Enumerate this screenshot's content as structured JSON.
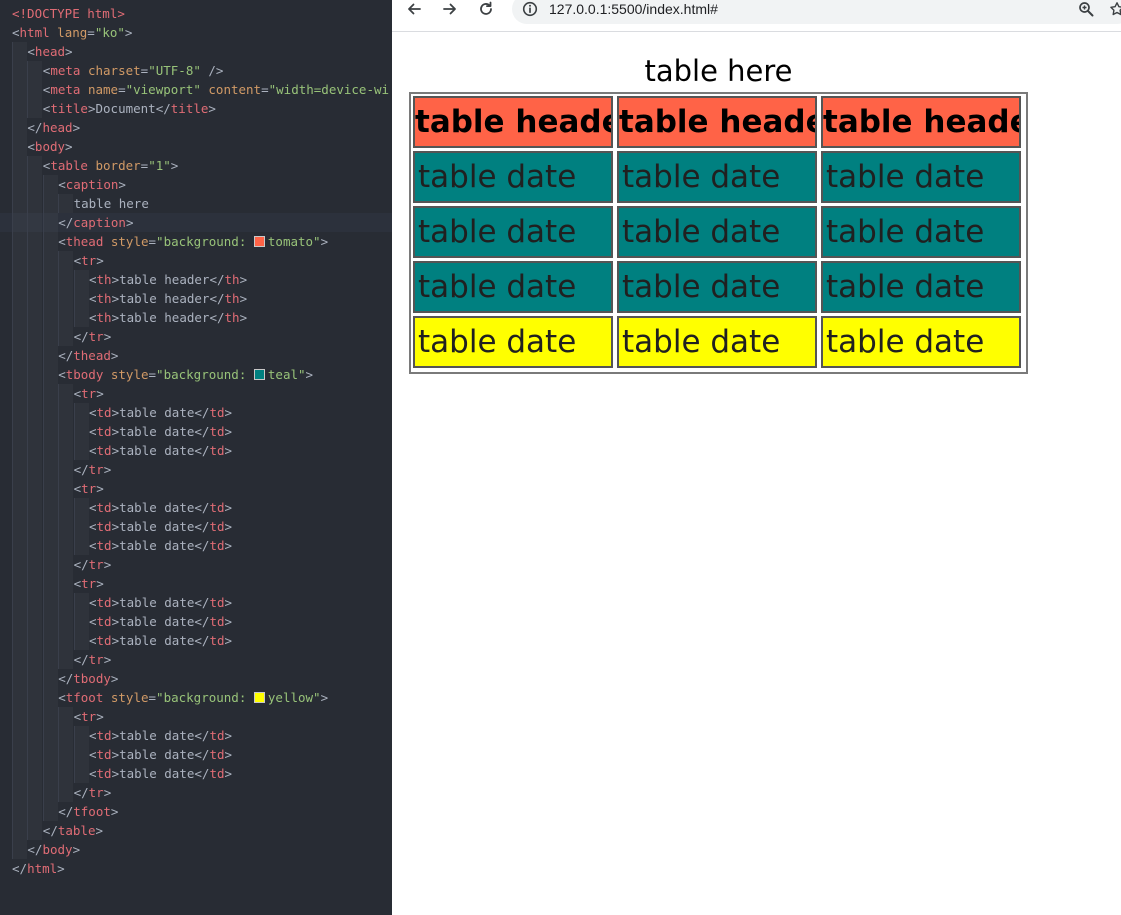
{
  "editor": {
    "lines": [
      {
        "indent": 0,
        "tokens": [
          [
            "tag",
            "<!DOCTYPE html>"
          ]
        ]
      },
      {
        "indent": 0,
        "tokens": [
          [
            "punc",
            "<"
          ],
          [
            "tag",
            "html"
          ],
          [
            "attr",
            " lang"
          ],
          [
            "punc",
            "="
          ],
          [
            "str",
            "\"ko\""
          ],
          [
            "punc",
            ">"
          ]
        ]
      },
      {
        "indent": 1,
        "tokens": [
          [
            "punc",
            "<"
          ],
          [
            "tag",
            "head"
          ],
          [
            "punc",
            ">"
          ]
        ]
      },
      {
        "indent": 2,
        "tokens": [
          [
            "punc",
            "<"
          ],
          [
            "tag",
            "meta"
          ],
          [
            "attr",
            " charset"
          ],
          [
            "punc",
            "="
          ],
          [
            "str",
            "\"UTF-8\""
          ],
          [
            "punc",
            " />"
          ]
        ]
      },
      {
        "indent": 2,
        "tokens": [
          [
            "punc",
            "<"
          ],
          [
            "tag",
            "meta"
          ],
          [
            "attr",
            " name"
          ],
          [
            "punc",
            "="
          ],
          [
            "str",
            "\"viewport\""
          ],
          [
            "attr",
            " content"
          ],
          [
            "punc",
            "="
          ],
          [
            "str",
            "\"width=device-wi"
          ]
        ]
      },
      {
        "indent": 2,
        "tokens": [
          [
            "punc",
            "<"
          ],
          [
            "tag",
            "title"
          ],
          [
            "punc",
            ">"
          ],
          [
            "text",
            "Document"
          ],
          [
            "punc",
            "</"
          ],
          [
            "tag",
            "title"
          ],
          [
            "punc",
            ">"
          ]
        ]
      },
      {
        "indent": 1,
        "tokens": [
          [
            "punc",
            "</"
          ],
          [
            "tag",
            "head"
          ],
          [
            "punc",
            ">"
          ]
        ]
      },
      {
        "indent": 1,
        "tokens": [
          [
            "punc",
            "<"
          ],
          [
            "tag",
            "body"
          ],
          [
            "punc",
            ">"
          ]
        ]
      },
      {
        "indent": 2,
        "tokens": [
          [
            "punc",
            "<"
          ],
          [
            "tag",
            "table"
          ],
          [
            "attr",
            " border"
          ],
          [
            "punc",
            "="
          ],
          [
            "str",
            "\"1\""
          ],
          [
            "punc",
            ">"
          ]
        ]
      },
      {
        "indent": 3,
        "tokens": [
          [
            "punc",
            "<"
          ],
          [
            "tag",
            "caption"
          ],
          [
            "punc",
            ">"
          ]
        ]
      },
      {
        "indent": 4,
        "tokens": [
          [
            "text",
            "table here"
          ]
        ]
      },
      {
        "indent": 3,
        "active": true,
        "tokens": [
          [
            "punc",
            "</"
          ],
          [
            "tag",
            "caption"
          ],
          [
            "punc",
            ">"
          ]
        ]
      },
      {
        "indent": 3,
        "tokens": [
          [
            "punc",
            "<"
          ],
          [
            "tag",
            "thead"
          ],
          [
            "attr",
            " style"
          ],
          [
            "punc",
            "="
          ],
          [
            "str",
            "\"background: "
          ],
          [
            "swatch",
            "#ff6347"
          ],
          [
            "str",
            "tomato\""
          ],
          [
            "punc",
            ">"
          ]
        ]
      },
      {
        "indent": 4,
        "tokens": [
          [
            "punc",
            "<"
          ],
          [
            "tag",
            "tr"
          ],
          [
            "punc",
            ">"
          ]
        ]
      },
      {
        "indent": 5,
        "tokens": [
          [
            "punc",
            "<"
          ],
          [
            "tag",
            "th"
          ],
          [
            "punc",
            ">"
          ],
          [
            "text",
            "table header"
          ],
          [
            "punc",
            "</"
          ],
          [
            "tag",
            "th"
          ],
          [
            "punc",
            ">"
          ]
        ]
      },
      {
        "indent": 5,
        "tokens": [
          [
            "punc",
            "<"
          ],
          [
            "tag",
            "th"
          ],
          [
            "punc",
            ">"
          ],
          [
            "text",
            "table header"
          ],
          [
            "punc",
            "</"
          ],
          [
            "tag",
            "th"
          ],
          [
            "punc",
            ">"
          ]
        ]
      },
      {
        "indent": 5,
        "tokens": [
          [
            "punc",
            "<"
          ],
          [
            "tag",
            "th"
          ],
          [
            "punc",
            ">"
          ],
          [
            "text",
            "table header"
          ],
          [
            "punc",
            "</"
          ],
          [
            "tag",
            "th"
          ],
          [
            "punc",
            ">"
          ]
        ]
      },
      {
        "indent": 4,
        "tokens": [
          [
            "punc",
            "</"
          ],
          [
            "tag",
            "tr"
          ],
          [
            "punc",
            ">"
          ]
        ]
      },
      {
        "indent": 3,
        "tokens": [
          [
            "punc",
            "</"
          ],
          [
            "tag",
            "thead"
          ],
          [
            "punc",
            ">"
          ]
        ]
      },
      {
        "indent": 3,
        "tokens": [
          [
            "punc",
            "<"
          ],
          [
            "tag",
            "tbody"
          ],
          [
            "attr",
            " style"
          ],
          [
            "punc",
            "="
          ],
          [
            "str",
            "\"background: "
          ],
          [
            "swatch",
            "#008080"
          ],
          [
            "str",
            "teal\""
          ],
          [
            "punc",
            ">"
          ]
        ]
      },
      {
        "indent": 4,
        "tokens": [
          [
            "punc",
            "<"
          ],
          [
            "tag",
            "tr"
          ],
          [
            "punc",
            ">"
          ]
        ]
      },
      {
        "indent": 5,
        "tokens": [
          [
            "punc",
            "<"
          ],
          [
            "tag",
            "td"
          ],
          [
            "punc",
            ">"
          ],
          [
            "text",
            "table date"
          ],
          [
            "punc",
            "</"
          ],
          [
            "tag",
            "td"
          ],
          [
            "punc",
            ">"
          ]
        ]
      },
      {
        "indent": 5,
        "tokens": [
          [
            "punc",
            "<"
          ],
          [
            "tag",
            "td"
          ],
          [
            "punc",
            ">"
          ],
          [
            "text",
            "table date"
          ],
          [
            "punc",
            "</"
          ],
          [
            "tag",
            "td"
          ],
          [
            "punc",
            ">"
          ]
        ]
      },
      {
        "indent": 5,
        "tokens": [
          [
            "punc",
            "<"
          ],
          [
            "tag",
            "td"
          ],
          [
            "punc",
            ">"
          ],
          [
            "text",
            "table date"
          ],
          [
            "punc",
            "</"
          ],
          [
            "tag",
            "td"
          ],
          [
            "punc",
            ">"
          ]
        ]
      },
      {
        "indent": 4,
        "tokens": [
          [
            "punc",
            "</"
          ],
          [
            "tag",
            "tr"
          ],
          [
            "punc",
            ">"
          ]
        ]
      },
      {
        "indent": 4,
        "tokens": [
          [
            "punc",
            "<"
          ],
          [
            "tag",
            "tr"
          ],
          [
            "punc",
            ">"
          ]
        ]
      },
      {
        "indent": 5,
        "tokens": [
          [
            "punc",
            "<"
          ],
          [
            "tag",
            "td"
          ],
          [
            "punc",
            ">"
          ],
          [
            "text",
            "table date"
          ],
          [
            "punc",
            "</"
          ],
          [
            "tag",
            "td"
          ],
          [
            "punc",
            ">"
          ]
        ]
      },
      {
        "indent": 5,
        "tokens": [
          [
            "punc",
            "<"
          ],
          [
            "tag",
            "td"
          ],
          [
            "punc",
            ">"
          ],
          [
            "text",
            "table date"
          ],
          [
            "punc",
            "</"
          ],
          [
            "tag",
            "td"
          ],
          [
            "punc",
            ">"
          ]
        ]
      },
      {
        "indent": 5,
        "tokens": [
          [
            "punc",
            "<"
          ],
          [
            "tag",
            "td"
          ],
          [
            "punc",
            ">"
          ],
          [
            "text",
            "table date"
          ],
          [
            "punc",
            "</"
          ],
          [
            "tag",
            "td"
          ],
          [
            "punc",
            ">"
          ]
        ]
      },
      {
        "indent": 4,
        "tokens": [
          [
            "punc",
            "</"
          ],
          [
            "tag",
            "tr"
          ],
          [
            "punc",
            ">"
          ]
        ]
      },
      {
        "indent": 4,
        "tokens": [
          [
            "punc",
            "<"
          ],
          [
            "tag",
            "tr"
          ],
          [
            "punc",
            ">"
          ]
        ]
      },
      {
        "indent": 5,
        "tokens": [
          [
            "punc",
            "<"
          ],
          [
            "tag",
            "td"
          ],
          [
            "punc",
            ">"
          ],
          [
            "text",
            "table date"
          ],
          [
            "punc",
            "</"
          ],
          [
            "tag",
            "td"
          ],
          [
            "punc",
            ">"
          ]
        ]
      },
      {
        "indent": 5,
        "tokens": [
          [
            "punc",
            "<"
          ],
          [
            "tag",
            "td"
          ],
          [
            "punc",
            ">"
          ],
          [
            "text",
            "table date"
          ],
          [
            "punc",
            "</"
          ],
          [
            "tag",
            "td"
          ],
          [
            "punc",
            ">"
          ]
        ]
      },
      {
        "indent": 5,
        "tokens": [
          [
            "punc",
            "<"
          ],
          [
            "tag",
            "td"
          ],
          [
            "punc",
            ">"
          ],
          [
            "text",
            "table date"
          ],
          [
            "punc",
            "</"
          ],
          [
            "tag",
            "td"
          ],
          [
            "punc",
            ">"
          ]
        ]
      },
      {
        "indent": 4,
        "tokens": [
          [
            "punc",
            "</"
          ],
          [
            "tag",
            "tr"
          ],
          [
            "punc",
            ">"
          ]
        ]
      },
      {
        "indent": 3,
        "tokens": [
          [
            "punc",
            "</"
          ],
          [
            "tag",
            "tbody"
          ],
          [
            "punc",
            ">"
          ]
        ]
      },
      {
        "indent": 3,
        "tokens": [
          [
            "punc",
            "<"
          ],
          [
            "tag",
            "tfoot"
          ],
          [
            "attr",
            " style"
          ],
          [
            "punc",
            "="
          ],
          [
            "str",
            "\"background: "
          ],
          [
            "swatch",
            "#ffff00"
          ],
          [
            "str",
            "yellow\""
          ],
          [
            "punc",
            ">"
          ]
        ]
      },
      {
        "indent": 4,
        "tokens": [
          [
            "punc",
            "<"
          ],
          [
            "tag",
            "tr"
          ],
          [
            "punc",
            ">"
          ]
        ]
      },
      {
        "indent": 5,
        "tokens": [
          [
            "punc",
            "<"
          ],
          [
            "tag",
            "td"
          ],
          [
            "punc",
            ">"
          ],
          [
            "text",
            "table date"
          ],
          [
            "punc",
            "</"
          ],
          [
            "tag",
            "td"
          ],
          [
            "punc",
            ">"
          ]
        ]
      },
      {
        "indent": 5,
        "tokens": [
          [
            "punc",
            "<"
          ],
          [
            "tag",
            "td"
          ],
          [
            "punc",
            ">"
          ],
          [
            "text",
            "table date"
          ],
          [
            "punc",
            "</"
          ],
          [
            "tag",
            "td"
          ],
          [
            "punc",
            ">"
          ]
        ]
      },
      {
        "indent": 5,
        "tokens": [
          [
            "punc",
            "<"
          ],
          [
            "tag",
            "td"
          ],
          [
            "punc",
            ">"
          ],
          [
            "text",
            "table date"
          ],
          [
            "punc",
            "</"
          ],
          [
            "tag",
            "td"
          ],
          [
            "punc",
            ">"
          ]
        ]
      },
      {
        "indent": 4,
        "tokens": [
          [
            "punc",
            "</"
          ],
          [
            "tag",
            "tr"
          ],
          [
            "punc",
            ">"
          ]
        ]
      },
      {
        "indent": 3,
        "tokens": [
          [
            "punc",
            "</"
          ],
          [
            "tag",
            "tfoot"
          ],
          [
            "punc",
            ">"
          ]
        ]
      },
      {
        "indent": 2,
        "tokens": [
          [
            "punc",
            "</"
          ],
          [
            "tag",
            "table"
          ],
          [
            "punc",
            ">"
          ]
        ]
      },
      {
        "indent": 1,
        "tokens": [
          [
            "punc",
            "</"
          ],
          [
            "tag",
            "body"
          ],
          [
            "punc",
            ">"
          ]
        ]
      },
      {
        "indent": 0,
        "tokens": [
          [
            "punc",
            "</"
          ],
          [
            "tag",
            "html"
          ],
          [
            "punc",
            ">"
          ]
        ]
      }
    ]
  },
  "browser": {
    "url": "127.0.0.1:5500/index.html#",
    "icons": {
      "back": "arrow-left-icon",
      "forward": "arrow-right-icon",
      "reload": "reload-icon",
      "site_info": "info-icon",
      "zoom": "zoom-icon",
      "bookmark": "star-icon"
    }
  },
  "page": {
    "caption": "table here",
    "header_row": [
      "table header",
      "table header",
      "table header"
    ],
    "body_rows": [
      [
        "table date",
        "table date",
        "table date"
      ],
      [
        "table date",
        "table date",
        "table date"
      ],
      [
        "table date",
        "table date",
        "table date"
      ]
    ],
    "footer_row": [
      "table date",
      "table date",
      "table date"
    ],
    "colors": {
      "thead": "#ff6347",
      "tbody": "#008080",
      "tfoot": "#ffff00"
    }
  }
}
